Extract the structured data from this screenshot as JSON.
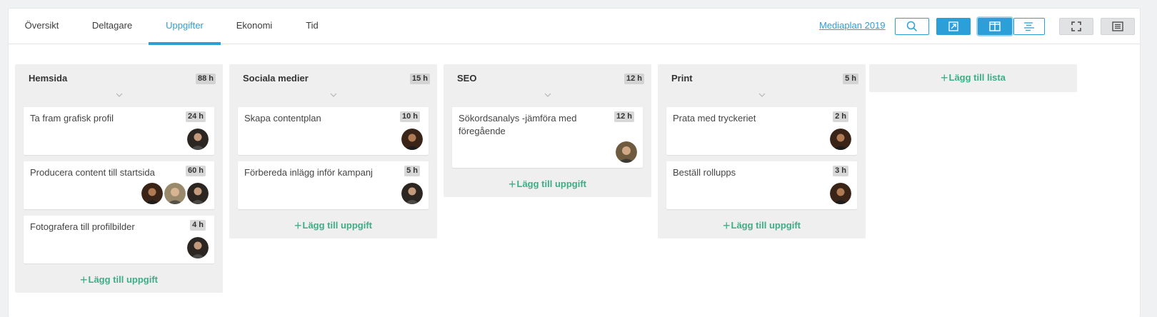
{
  "tabs": [
    {
      "label": "Översikt"
    },
    {
      "label": "Deltagare"
    },
    {
      "label": "Uppgifter",
      "active": true
    },
    {
      "label": "Ekonomi"
    },
    {
      "label": "Tid"
    }
  ],
  "project_link": "Mediaplan 2019",
  "toolbar": {
    "search_icon": "search-icon",
    "export_icon": "external-link-icon",
    "board_icon": "board-view-icon",
    "gantt_icon": "gantt-view-icon",
    "fullscreen_icon": "fullscreen-icon",
    "list_icon": "list-view-icon"
  },
  "colors": {
    "accent": "#2d9fd8",
    "add_green": "#3cae86",
    "column_bg": "#efefef"
  },
  "add_task_label": "Lägg till uppgift",
  "add_list_label": "Lägg till lista",
  "columns": [
    {
      "title": "Hemsida",
      "hours": "88 h",
      "cards": [
        {
          "title": "Ta fram grafisk profil",
          "hours": "24 h",
          "avatars": [
            "avatar"
          ]
        },
        {
          "title": "Producera content till startsida",
          "hours": "60 h",
          "avatars": [
            "avatar",
            "avatar",
            "avatar"
          ]
        },
        {
          "title": "Fotografera till profilbilder",
          "hours": "4 h",
          "avatars": [
            "avatar"
          ]
        }
      ]
    },
    {
      "title": "Sociala medier",
      "hours": "15 h",
      "cards": [
        {
          "title": "Skapa contentplan",
          "hours": "10 h",
          "avatars": [
            "avatar"
          ]
        },
        {
          "title": "Förbereda inlägg inför kampanj",
          "hours": "5 h",
          "avatars": [
            "avatar"
          ]
        }
      ]
    },
    {
      "title": "SEO",
      "hours": "12 h",
      "cards": [
        {
          "title": "Sökordsanalys -jämföra med föregående",
          "hours": "12 h",
          "avatars": [
            "avatar"
          ]
        }
      ]
    },
    {
      "title": "Print",
      "hours": "5 h",
      "cards": [
        {
          "title": "Prata med tryckeriet",
          "hours": "2 h",
          "avatars": [
            "avatar"
          ]
        },
        {
          "title": "Beställ rollupps",
          "hours": "3 h",
          "avatars": [
            "avatar"
          ]
        }
      ]
    }
  ]
}
